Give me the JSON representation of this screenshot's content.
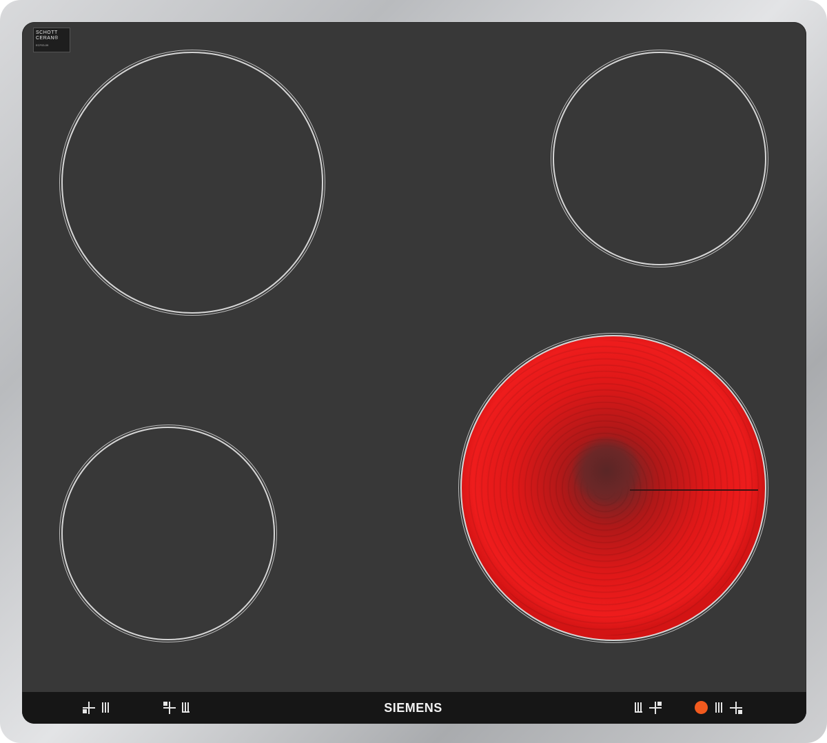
{
  "logo": {
    "line1": "SCHOTT",
    "line2": "CERAN®",
    "line3": "ECF03-09"
  },
  "brand": "SIEMENS",
  "zones": [
    {
      "name": "zone-rear-left",
      "state": "off"
    },
    {
      "name": "zone-rear-right",
      "state": "off"
    },
    {
      "name": "zone-front-left",
      "state": "off"
    },
    {
      "name": "zone-front-right",
      "state": "on"
    }
  ],
  "indicator": {
    "color": "#f25a1e",
    "state": "on"
  },
  "colors": {
    "glass": "#383838",
    "frame": "#c4c5c7",
    "hot_zone": "#ee1c1c",
    "ring": "#d6d6d6"
  },
  "icons": [
    "zone-rear-left-icon",
    "zone-front-left-icon",
    "zone-front-right-icon",
    "zone-rear-right-icon"
  ]
}
